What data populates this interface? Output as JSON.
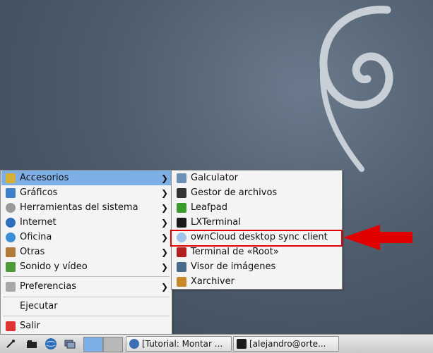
{
  "main_menu": {
    "items": [
      {
        "label": "Accesorios",
        "icon": "accessories-icon",
        "has_submenu": true,
        "selected": true
      },
      {
        "label": "Gráficos",
        "icon": "graphics-icon",
        "has_submenu": true
      },
      {
        "label": "Herramientas del sistema",
        "icon": "system-tools-icon",
        "has_submenu": true
      },
      {
        "label": "Internet",
        "icon": "internet-globe-icon",
        "has_submenu": true
      },
      {
        "label": "Oficina",
        "icon": "office-icon",
        "has_submenu": true
      },
      {
        "label": "Otras",
        "icon": "other-icon",
        "has_submenu": true
      },
      {
        "label": "Sonido y vídeo",
        "icon": "sound-video-icon",
        "has_submenu": true
      },
      {
        "label": "Preferencias",
        "icon": "preferences-icon",
        "has_submenu": true
      },
      {
        "label": "Ejecutar",
        "icon": "",
        "has_submenu": false
      },
      {
        "label": "Salir",
        "icon": "logout-icon",
        "has_submenu": false
      }
    ]
  },
  "submenu": {
    "items": [
      {
        "label": "Galculator",
        "icon": "calculator-icon"
      },
      {
        "label": "Gestor de archivos",
        "icon": "file-manager-icon"
      },
      {
        "label": "Leafpad",
        "icon": "leafpad-icon"
      },
      {
        "label": "LXTerminal",
        "icon": "terminal-icon"
      },
      {
        "label": "ownCloud desktop sync client",
        "icon": "owncloud-icon",
        "highlighted": true
      },
      {
        "label": "Terminal de «Root»",
        "icon": "root-terminal-icon"
      },
      {
        "label": "Visor de imágenes",
        "icon": "image-viewer-icon"
      },
      {
        "label": "Xarchiver",
        "icon": "xarchiver-icon"
      }
    ]
  },
  "taskbar": {
    "tasks": [
      {
        "label": "[Tutorial: Montar ...",
        "icon": "browser-icon"
      },
      {
        "label": "[alejandro@orte...",
        "icon": "terminal-icon"
      }
    ]
  },
  "colors": {
    "selection": "#7eaee6",
    "annotation_red": "#e00000"
  }
}
